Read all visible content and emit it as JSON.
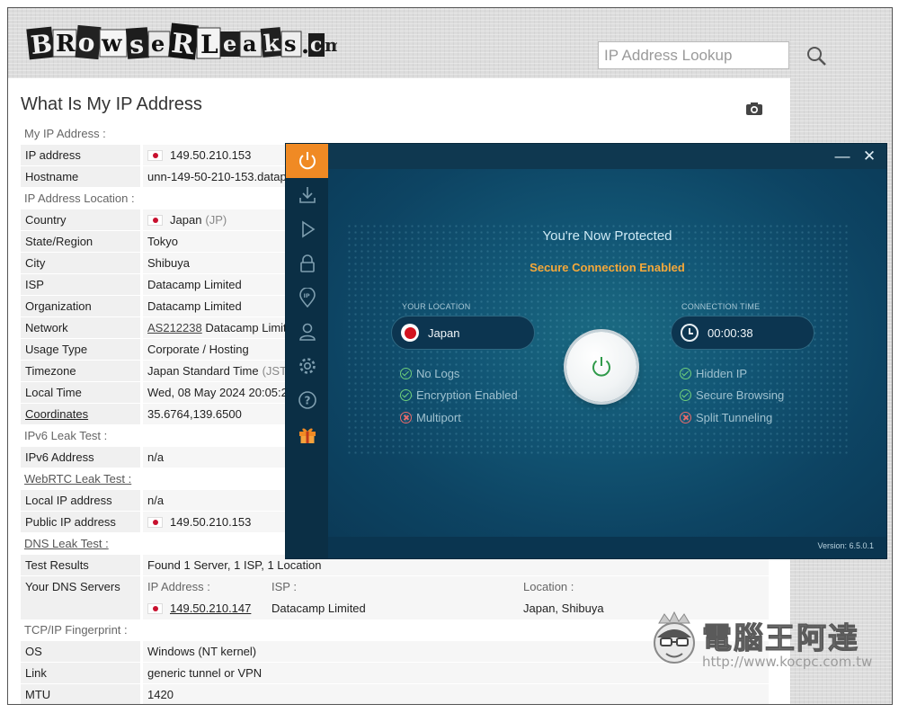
{
  "site": {
    "logo_text": "BrowserLeaks.com",
    "search_placeholder": "IP Address Lookup"
  },
  "page": {
    "title": "What Is My IP Address"
  },
  "sections": {
    "my_ip": "My IP Address :",
    "location": "IP Address Location :",
    "ipv6": "IPv6 Leak Test :",
    "webrtc": "WebRTC Leak Test :",
    "dns": "DNS Leak Test :",
    "tcpip": "TCP/IP Fingerprint :"
  },
  "rows": {
    "ip_address": {
      "label": "IP address",
      "value": "149.50.210.153"
    },
    "hostname": {
      "label": "Hostname",
      "value": "unn-149-50-210-153.datapa"
    },
    "country": {
      "label": "Country",
      "value": "Japan",
      "code": "(JP)"
    },
    "state": {
      "label": "State/Region",
      "value": "Tokyo"
    },
    "city": {
      "label": "City",
      "value": "Shibuya"
    },
    "isp": {
      "label": "ISP",
      "value": "Datacamp Limited"
    },
    "organization": {
      "label": "Organization",
      "value": "Datacamp Limited"
    },
    "network": {
      "label": "Network",
      "asn": "AS212238",
      "value": "Datacamp Limite"
    },
    "usage": {
      "label": "Usage Type",
      "value": "Corporate / Hosting"
    },
    "timezone": {
      "label": "Timezone",
      "value": "Japan Standard Time",
      "code": "(JST)"
    },
    "local_time": {
      "label": "Local Time",
      "value": "Wed, 08 May 2024 20:05:21"
    },
    "coordinates": {
      "label": "Coordinates",
      "value": "35.6764,139.6500"
    },
    "ipv6_address": {
      "label": "IPv6 Address",
      "value": "n/a"
    },
    "local_ip": {
      "label": "Local IP address",
      "value": "n/a"
    },
    "public_ip": {
      "label": "Public IP address",
      "value": "149.50.210.153"
    },
    "test_results": {
      "label": "Test Results",
      "value": "Found 1 Server, 1 ISP, 1 Location"
    },
    "dns_servers": {
      "label": "Your DNS Servers"
    },
    "os": {
      "label": "OS",
      "value": "Windows (NT kernel)"
    },
    "link": {
      "label": "Link",
      "value": "generic tunnel or VPN"
    },
    "mtu": {
      "label": "MTU",
      "value": "1420"
    }
  },
  "dns_table": {
    "headers": [
      "IP Address :",
      "ISP :",
      "Location :"
    ],
    "row": [
      "149.50.210.147",
      "Datacamp Limited",
      "Japan, Shibuya"
    ]
  },
  "vpn": {
    "status": "You're Now Protected",
    "secure": "Secure Connection Enabled",
    "your_location_label": "YOUR LOCATION",
    "location": "Japan",
    "connection_time_label": "CONNECTION TIME",
    "time": "00:00:38",
    "left_features": [
      {
        "label": "No Logs",
        "state": "on"
      },
      {
        "label": "Encryption Enabled",
        "state": "on"
      },
      {
        "label": "Multiport",
        "state": "off"
      }
    ],
    "right_features": [
      {
        "label": "Hidden IP",
        "state": "on"
      },
      {
        "label": "Secure Browsing",
        "state": "on"
      },
      {
        "label": "Split Tunneling",
        "state": "off"
      }
    ],
    "version": "Version: 6.5.0.1",
    "minimize": "—",
    "close": "✕",
    "accent_color": "#f08a24"
  },
  "watermark": {
    "title": "電腦王阿達",
    "url": "http://www.kocpc.com.tw"
  }
}
